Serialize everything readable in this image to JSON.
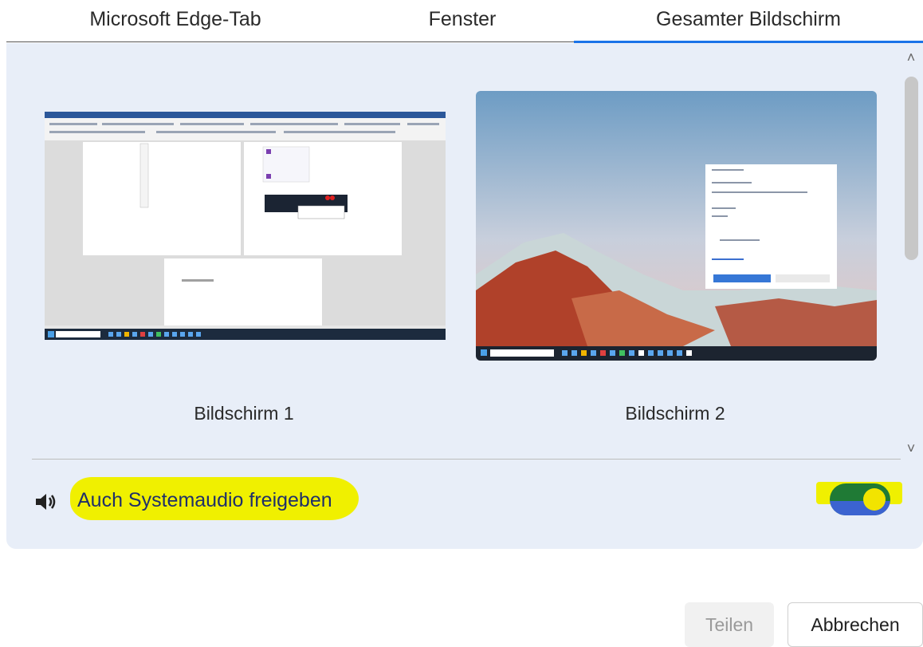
{
  "tabs": [
    {
      "label": "Microsoft Edge-Tab"
    },
    {
      "label": "Fenster"
    },
    {
      "label": "Gesamter Bildschirm",
      "active": true
    }
  ],
  "screens": [
    {
      "label": "Bildschirm 1"
    },
    {
      "label": "Bildschirm 2"
    }
  ],
  "audio": {
    "label": "Auch Systemaudio freigeben",
    "enabled": true,
    "icon": "speaker-icon"
  },
  "scrollbar": {
    "up_glyph": "˄",
    "down_glyph": "˅"
  },
  "buttons": {
    "share": "Teilen",
    "cancel": "Abbrechen"
  },
  "colors": {
    "accent": "#1a73e8",
    "panel": "#e8eef8",
    "highlight": "#f0f000"
  }
}
